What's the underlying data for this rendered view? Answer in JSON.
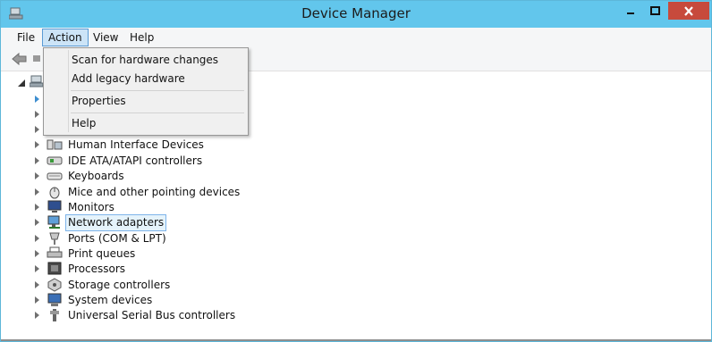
{
  "window": {
    "title": "Device Manager"
  },
  "menu": {
    "file": "File",
    "action": "Action",
    "view": "View",
    "help": "Help"
  },
  "action_menu": {
    "items": [
      "Scan for hardware changes",
      "Add legacy hardware",
      "Properties",
      "Help"
    ]
  },
  "tree": {
    "items": [
      {
        "label": "Human Interface Devices",
        "icon": "hid-icon"
      },
      {
        "label": "IDE ATA/ATAPI controllers",
        "icon": "ide-controller-icon"
      },
      {
        "label": "Keyboards",
        "icon": "keyboard-icon"
      },
      {
        "label": "Mice and other pointing devices",
        "icon": "mouse-icon"
      },
      {
        "label": "Monitors",
        "icon": "monitor-icon"
      },
      {
        "label": "Network adapters",
        "icon": "network-adapter-icon",
        "selected": true
      },
      {
        "label": "Ports (COM & LPT)",
        "icon": "port-icon"
      },
      {
        "label": "Print queues",
        "icon": "printer-icon"
      },
      {
        "label": "Processors",
        "icon": "processor-icon"
      },
      {
        "label": "Storage controllers",
        "icon": "storage-controller-icon"
      },
      {
        "label": "System devices",
        "icon": "system-devices-icon"
      },
      {
        "label": "Universal Serial Bus controllers",
        "icon": "usb-icon"
      }
    ]
  },
  "colors": {
    "titlebar": "#62c6ec",
    "close": "#c74a3c",
    "selection": "#e5f3fb"
  }
}
